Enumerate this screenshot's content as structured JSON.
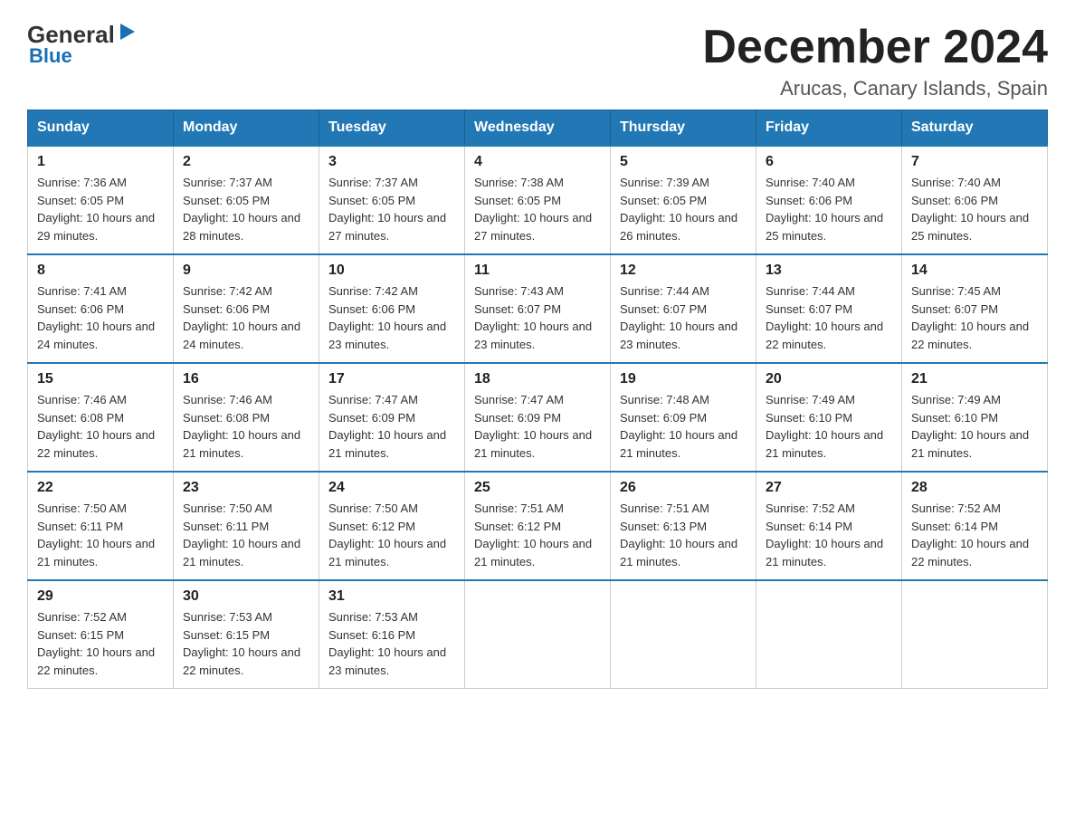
{
  "logo": {
    "text_general": "General",
    "text_blue": "Blue",
    "arrow": "▶"
  },
  "header": {
    "month_year": "December 2024",
    "location": "Arucas, Canary Islands, Spain"
  },
  "days_of_week": [
    "Sunday",
    "Monday",
    "Tuesday",
    "Wednesday",
    "Thursday",
    "Friday",
    "Saturday"
  ],
  "weeks": [
    [
      {
        "day": "1",
        "sunrise": "7:36 AM",
        "sunset": "6:05 PM",
        "daylight": "10 hours and 29 minutes."
      },
      {
        "day": "2",
        "sunrise": "7:37 AM",
        "sunset": "6:05 PM",
        "daylight": "10 hours and 28 minutes."
      },
      {
        "day": "3",
        "sunrise": "7:37 AM",
        "sunset": "6:05 PM",
        "daylight": "10 hours and 27 minutes."
      },
      {
        "day": "4",
        "sunrise": "7:38 AM",
        "sunset": "6:05 PM",
        "daylight": "10 hours and 27 minutes."
      },
      {
        "day": "5",
        "sunrise": "7:39 AM",
        "sunset": "6:05 PM",
        "daylight": "10 hours and 26 minutes."
      },
      {
        "day": "6",
        "sunrise": "7:40 AM",
        "sunset": "6:06 PM",
        "daylight": "10 hours and 25 minutes."
      },
      {
        "day": "7",
        "sunrise": "7:40 AM",
        "sunset": "6:06 PM",
        "daylight": "10 hours and 25 minutes."
      }
    ],
    [
      {
        "day": "8",
        "sunrise": "7:41 AM",
        "sunset": "6:06 PM",
        "daylight": "10 hours and 24 minutes."
      },
      {
        "day": "9",
        "sunrise": "7:42 AM",
        "sunset": "6:06 PM",
        "daylight": "10 hours and 24 minutes."
      },
      {
        "day": "10",
        "sunrise": "7:42 AM",
        "sunset": "6:06 PM",
        "daylight": "10 hours and 23 minutes."
      },
      {
        "day": "11",
        "sunrise": "7:43 AM",
        "sunset": "6:07 PM",
        "daylight": "10 hours and 23 minutes."
      },
      {
        "day": "12",
        "sunrise": "7:44 AM",
        "sunset": "6:07 PM",
        "daylight": "10 hours and 23 minutes."
      },
      {
        "day": "13",
        "sunrise": "7:44 AM",
        "sunset": "6:07 PM",
        "daylight": "10 hours and 22 minutes."
      },
      {
        "day": "14",
        "sunrise": "7:45 AM",
        "sunset": "6:07 PM",
        "daylight": "10 hours and 22 minutes."
      }
    ],
    [
      {
        "day": "15",
        "sunrise": "7:46 AM",
        "sunset": "6:08 PM",
        "daylight": "10 hours and 22 minutes."
      },
      {
        "day": "16",
        "sunrise": "7:46 AM",
        "sunset": "6:08 PM",
        "daylight": "10 hours and 21 minutes."
      },
      {
        "day": "17",
        "sunrise": "7:47 AM",
        "sunset": "6:09 PM",
        "daylight": "10 hours and 21 minutes."
      },
      {
        "day": "18",
        "sunrise": "7:47 AM",
        "sunset": "6:09 PM",
        "daylight": "10 hours and 21 minutes."
      },
      {
        "day": "19",
        "sunrise": "7:48 AM",
        "sunset": "6:09 PM",
        "daylight": "10 hours and 21 minutes."
      },
      {
        "day": "20",
        "sunrise": "7:49 AM",
        "sunset": "6:10 PM",
        "daylight": "10 hours and 21 minutes."
      },
      {
        "day": "21",
        "sunrise": "7:49 AM",
        "sunset": "6:10 PM",
        "daylight": "10 hours and 21 minutes."
      }
    ],
    [
      {
        "day": "22",
        "sunrise": "7:50 AM",
        "sunset": "6:11 PM",
        "daylight": "10 hours and 21 minutes."
      },
      {
        "day": "23",
        "sunrise": "7:50 AM",
        "sunset": "6:11 PM",
        "daylight": "10 hours and 21 minutes."
      },
      {
        "day": "24",
        "sunrise": "7:50 AM",
        "sunset": "6:12 PM",
        "daylight": "10 hours and 21 minutes."
      },
      {
        "day": "25",
        "sunrise": "7:51 AM",
        "sunset": "6:12 PM",
        "daylight": "10 hours and 21 minutes."
      },
      {
        "day": "26",
        "sunrise": "7:51 AM",
        "sunset": "6:13 PM",
        "daylight": "10 hours and 21 minutes."
      },
      {
        "day": "27",
        "sunrise": "7:52 AM",
        "sunset": "6:14 PM",
        "daylight": "10 hours and 21 minutes."
      },
      {
        "day": "28",
        "sunrise": "7:52 AM",
        "sunset": "6:14 PM",
        "daylight": "10 hours and 22 minutes."
      }
    ],
    [
      {
        "day": "29",
        "sunrise": "7:52 AM",
        "sunset": "6:15 PM",
        "daylight": "10 hours and 22 minutes."
      },
      {
        "day": "30",
        "sunrise": "7:53 AM",
        "sunset": "6:15 PM",
        "daylight": "10 hours and 22 minutes."
      },
      {
        "day": "31",
        "sunrise": "7:53 AM",
        "sunset": "6:16 PM",
        "daylight": "10 hours and 23 minutes."
      },
      null,
      null,
      null,
      null
    ]
  ],
  "labels": {
    "sunrise": "Sunrise:",
    "sunset": "Sunset:",
    "daylight": "Daylight:"
  }
}
